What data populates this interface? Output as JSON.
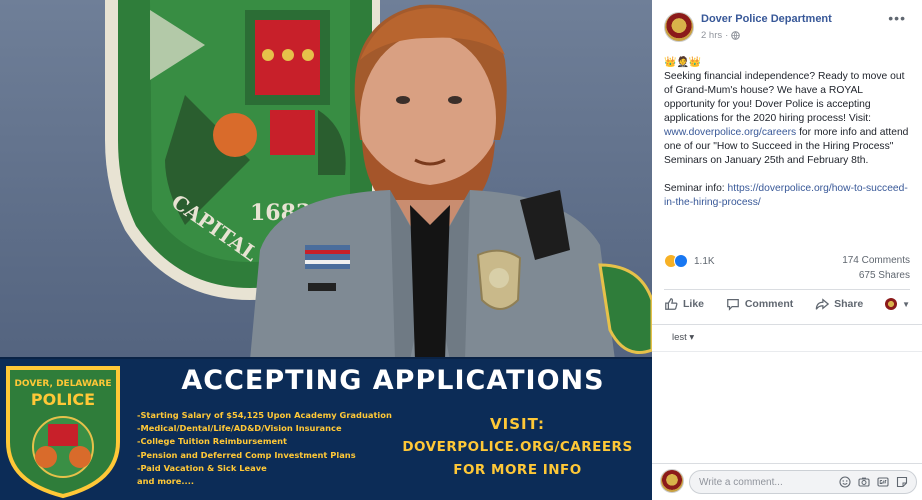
{
  "photo": {
    "banner_badge": {
      "arc_top": "DOVER, DELAWARE",
      "title": "POLICE"
    },
    "wall_patch": {
      "year": "1683",
      "motto": "CAPITAL OF TH"
    },
    "heading": "ACCEPTING APPLICATIONS",
    "benefits": [
      "-Starting Salary of $54,125 Upon Academy Graduation",
      "-Medical/Dental/Life/AD&D/Vision Insurance",
      "-College Tuition Reimbursement",
      "-Pension and Deferred Comp Investment Plans",
      "-Paid Vacation & Sick Leave",
      "and more...."
    ],
    "visit": {
      "line1": "VISIT:",
      "line2": "DOVERPOLICE.ORG/CAREERS",
      "line3": "FOR MORE INFO"
    },
    "colors": {
      "banner": "#0c2c57",
      "accent_text": "#ffc837",
      "patch_green": "#2f7d3a"
    }
  },
  "post": {
    "page_name": "Dover Police Department",
    "time": "2 hrs",
    "privacy_icon": "globe-icon",
    "more_icon": "more-options-icon",
    "emoji_line": "👑🤵👑",
    "text": {
      "p1_before_link": "Seeking financial independence? Ready to move out of Grand-Mum's house? We have a ROYAL opportunity for you! Dover Police is accepting applications for the 2020 hiring process! Visit: ",
      "p1_link": "www.doverpolice.org/careers",
      "p1_after_link": " for more info and attend one of our \"How to Succeed in the Hiring Process\" Seminars on January 25th and February 8th.",
      "p2_before_link": "Seminar info: ",
      "p2_link": "https://doverpolice.org/how-to-succeed-in-the-hiring-process/"
    },
    "reactions_count": "1.1K",
    "comments_count": "174 Comments",
    "shares_count": "675 Shares",
    "actions": {
      "like": "Like",
      "comment": "Comment",
      "share": "Share"
    },
    "sort_label": "lest ▾",
    "comment_placeholder": "Write a comment...",
    "colors": {
      "link": "#385898",
      "muted": "#606770",
      "like_blue": "#1877f2",
      "haha_yellow": "#f7b125"
    }
  }
}
